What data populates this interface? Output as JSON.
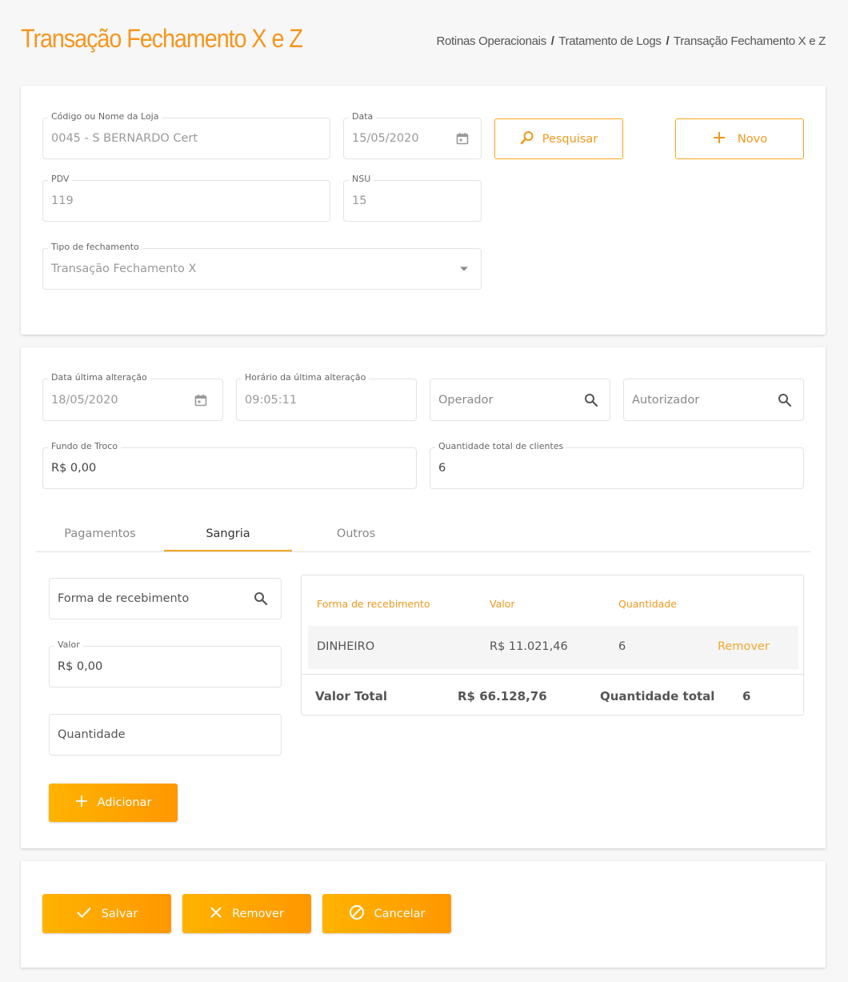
{
  "header": {
    "title": "Transação Fechamento X e Z",
    "breadcrumb": [
      "Rotinas Operacionais",
      "Tratamento de Logs",
      "Transação Fechamento X e Z"
    ],
    "breadcrumb_sep": "/"
  },
  "search_form": {
    "loja": {
      "label": "Código ou Nome da Loja",
      "value": "0045 - S BERNARDO Cert"
    },
    "data": {
      "label": "Data",
      "value": "15/05/2020"
    },
    "pdv": {
      "label": "PDV",
      "value": "119"
    },
    "nsu": {
      "label": "NSU",
      "value": "15"
    },
    "tipo": {
      "label": "Tipo de fechamento",
      "value": "Transação Fechamento X"
    },
    "pesquisar_label": "Pesquisar",
    "novo_label": "Novo"
  },
  "details": {
    "data_alteracao": {
      "label": "Data última alteração",
      "value": "18/05/2020"
    },
    "horario_alteracao": {
      "label": "Horário da última alteração",
      "value": "09:05:11"
    },
    "operador_placeholder": "Operador",
    "autorizador_placeholder": "Autorizador",
    "fundo_troco": {
      "label": "Fundo de Troco",
      "value": "R$ 0,00"
    },
    "qtd_clientes": {
      "label": "Quantidade total de clientes",
      "value": "6"
    }
  },
  "tabs": [
    {
      "label": "Pagamentos",
      "active": false
    },
    {
      "label": "Sangria",
      "active": true
    },
    {
      "label": "Outros",
      "active": false
    }
  ],
  "sangria": {
    "forma_placeholder": "Forma de recebimento",
    "valor": {
      "label": "Valor",
      "value": "R$ 0,00"
    },
    "quantidade_placeholder": "Quantidade",
    "adicionar_label": "Adicionar",
    "table": {
      "headers": [
        "Forma de recebimento",
        "Valor",
        "Quantidade"
      ],
      "rows": [
        {
          "forma": "DINHEIRO",
          "valor": "R$ 11.021,46",
          "quantidade": "6",
          "action": "Remover"
        }
      ],
      "footer": {
        "valor_total_label": "Valor Total",
        "valor_total": "R$ 66.128,76",
        "qtd_total_label": "Quantidade total",
        "qtd_total": "6"
      }
    }
  },
  "actions": {
    "salvar_label": "Salvar",
    "remover_label": "Remover",
    "cancelar_label": "Cancelar"
  },
  "colors": {
    "accent": "#f5961e",
    "button_gradient_start": "#ffb300",
    "button_gradient_end": "#ff9800",
    "background": "#f7f7f7"
  },
  "icons": [
    "search-icon",
    "plus-icon",
    "calendar-icon",
    "dropdown-arrow-icon",
    "check-icon",
    "close-icon",
    "cancel-icon"
  ]
}
